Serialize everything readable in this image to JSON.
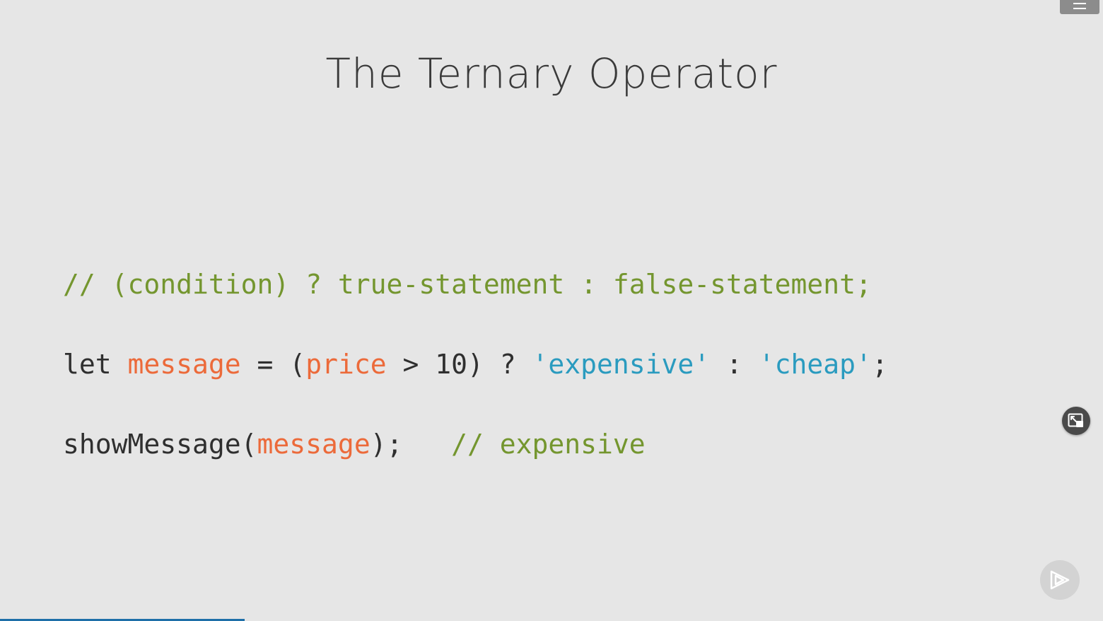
{
  "slide": {
    "title": "The Ternary Operator",
    "code": {
      "line1": {
        "comment": "// (condition) ? true-statement : false-statement;"
      },
      "line2": {
        "kw_let": "let ",
        "var_message": "message",
        "op_assign": " = (",
        "var_price": "price",
        "op_compare": " > 10) ? ",
        "str_expensive": "'expensive'",
        "op_colon": " : ",
        "str_cheap": "'cheap'",
        "end": ";"
      },
      "line3": {
        "fn_call": "showMessage(",
        "var_message": "message",
        "end": ");",
        "spacer": "   ",
        "comment": "// expensive"
      }
    }
  },
  "controls": {
    "menu_icon": "hamburger-menu-icon",
    "pip_icon": "picture-in-picture-icon",
    "brand_icon": "play-logo-icon"
  },
  "progress": {
    "fraction": 0.222
  },
  "colors": {
    "background": "#e6e6e6",
    "comment": "#74962f",
    "variable": "#ec6a3a",
    "string": "#2a9bbf",
    "text": "#2f2f2f",
    "progress": "#1e6fa8"
  }
}
